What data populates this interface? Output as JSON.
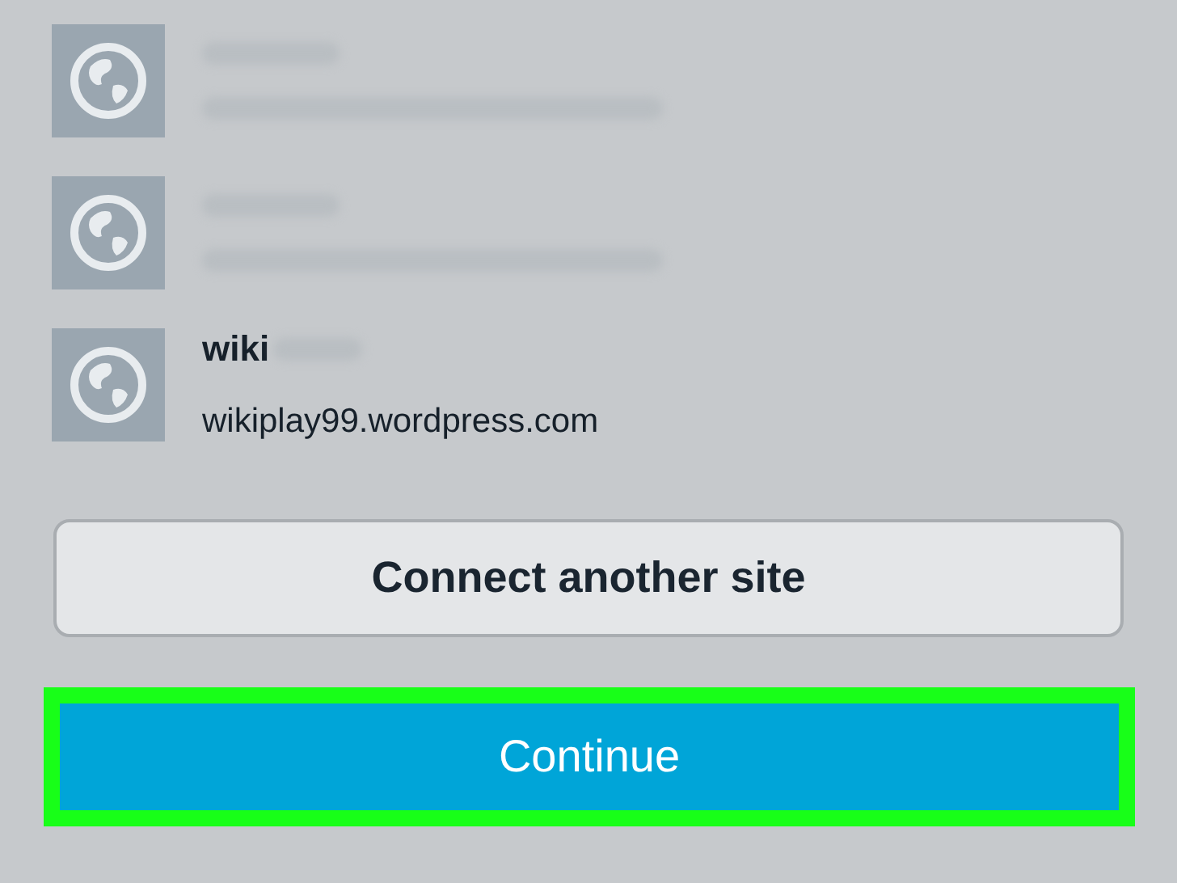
{
  "sites": [
    {
      "blurred": true
    },
    {
      "blurred": true
    },
    {
      "blurred": false,
      "name": "wiki",
      "url": "wikiplay99.wordpress.com"
    }
  ],
  "connect_button": {
    "label": "Connect another site"
  },
  "continue_button": {
    "label": "Continue",
    "highlighted": true
  }
}
